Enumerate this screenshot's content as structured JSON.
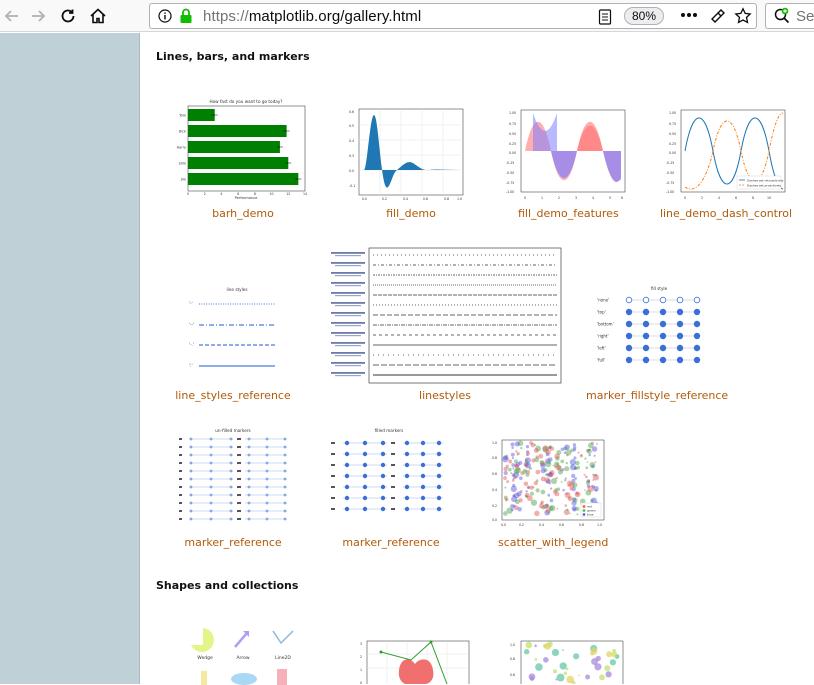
{
  "browser": {
    "url_scheme": "https://",
    "url_host_path": "matplotlib.org/gallery.html",
    "zoom": "80%",
    "search_placeholder": "Se"
  },
  "sections": [
    {
      "title": "Lines, bars, and markers"
    },
    {
      "title": "Shapes and collections"
    }
  ],
  "gallery": {
    "row1": [
      "barh_demo",
      "fill_demo",
      "fill_demo_features",
      "line_demo_dash_control"
    ],
    "row2": [
      "line_styles_reference",
      "linestyles",
      "marker_fillstyle_reference"
    ],
    "row3": [
      "marker_reference",
      "marker_reference",
      "scatter_with_legend"
    ]
  },
  "thumbs": {
    "barh_title": "How fast do you want to go today?",
    "barh_people": [
      "Tom",
      "Dick",
      "Harry",
      "Slim",
      "Jim"
    ],
    "barh_xlabel": "Performance",
    "barh_values": [
      3.2,
      11.8,
      11.0,
      12.0,
      13.2
    ],
    "line_styles_title": "line styles",
    "line_styles_labels": [
      "'-'",
      "'--'",
      "'-.'",
      "':'"
    ],
    "fill_style_title": "fill style",
    "fill_style_labels": [
      "'none'",
      "'top'",
      "'bottom'",
      "'right'",
      "'left'",
      "'full'"
    ],
    "unfilled_title": "un-filled markers",
    "filled_title": "filled markers",
    "legend_dash": [
      "Dashes set retroactively",
      "Dashes set proactively"
    ],
    "scatter_legend": [
      "red",
      "green",
      "blue"
    ],
    "shapes_labels": [
      "Wedge",
      "Arrow",
      "Line2D"
    ]
  },
  "colors": {
    "link": "#b05b08",
    "side_panel": "#bfd0d6",
    "bar_green": "#008000",
    "fill_blue": "#1f77b4"
  }
}
